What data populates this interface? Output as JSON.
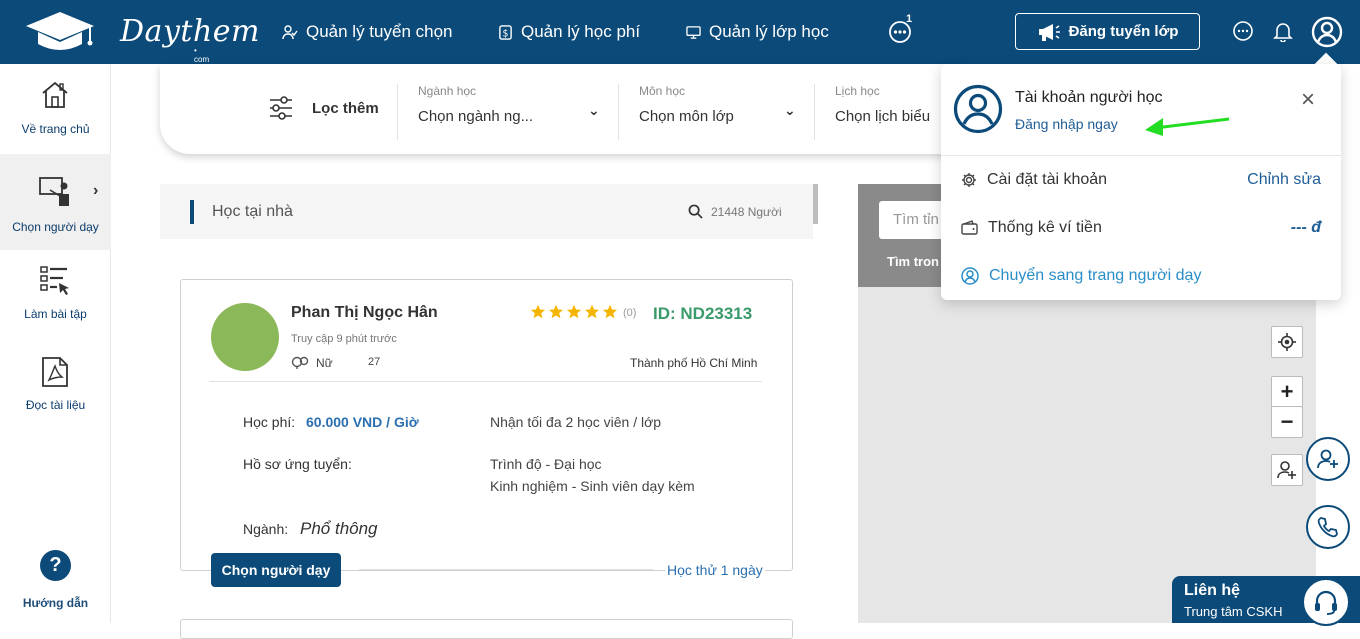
{
  "header": {
    "logo_text": "Daythem",
    "logo_sub": "• com",
    "nav": [
      {
        "label": "Quản lý tuyển chọn",
        "icon": "users-check-icon"
      },
      {
        "label": "Quản lý học phí",
        "icon": "dollar-receipt-icon"
      },
      {
        "label": "Quản lý lớp học",
        "icon": "monitor-icon"
      }
    ],
    "more_badge": "1",
    "post_button": "Đăng tuyển lớp"
  },
  "sidebar": {
    "items": [
      {
        "label": "Về trang chủ",
        "icon": "home-icon"
      },
      {
        "label": "Chọn người dạy",
        "icon": "teacher-board-icon"
      },
      {
        "label": "Làm bài tập",
        "icon": "checklist-icon"
      },
      {
        "label": "Đọc tài liệu",
        "icon": "pdf-icon"
      }
    ],
    "help_label": "Hướng dẫn"
  },
  "filter": {
    "more_label": "Lọc thêm",
    "fields": [
      {
        "label": "Ngành học",
        "value": "Chọn ngành ng..."
      },
      {
        "label": "Môn học",
        "value": "Chọn môn lớp"
      },
      {
        "label": "Lịch học",
        "value": "Chọn lịch biểu"
      }
    ]
  },
  "search": {
    "title": "Học tại nhà",
    "count": "21448 Người"
  },
  "card": {
    "name": "Phan Thị Ngọc Hân",
    "last_seen": "Truy cập 9 phút trước",
    "gender": "Nữ",
    "age": "27",
    "rating_count": "(0)",
    "stars": 5,
    "id": "ID: ND23313",
    "city": "Thành phố Hồ Chí Minh",
    "fee_label": "Học phí:",
    "fee_value": "60.000 VND / Giờ",
    "capacity": "Nhận tối đa 2 học viên / lớp",
    "profile_label": "Hồ sơ ứng tuyển:",
    "level": "Trình độ - Đại học",
    "experience": "Kinh nghiệm - Sinh viên dạy kèm",
    "major_label": "Ngành:",
    "major_value": "Phổ thông",
    "trial": "Học thử 1 ngày",
    "choose_button": "Chọn người dạy"
  },
  "map": {
    "search_placeholder": "Tìm tỉn",
    "hint": "Tìm tron",
    "zoom_in": "+",
    "zoom_out": "−"
  },
  "support": {
    "title": "Liên hệ",
    "subtitle": "Trung tâm CSKH"
  },
  "account_menu": {
    "title": "Tài khoản người học",
    "login_link": "Đăng nhập ngay",
    "rows": [
      {
        "label": "Cài đặt tài khoản",
        "action": "Chỉnh sửa"
      },
      {
        "label": "Thống kê ví tiền",
        "action": "--- đ"
      }
    ],
    "switch_label": "Chuyển sang trang người dạy"
  },
  "colors": {
    "brand": "#0b4a79",
    "green_id": "#3a9a6a",
    "star": "#f5b400",
    "link": "#2a6fb0",
    "arrow": "#22dd22"
  }
}
